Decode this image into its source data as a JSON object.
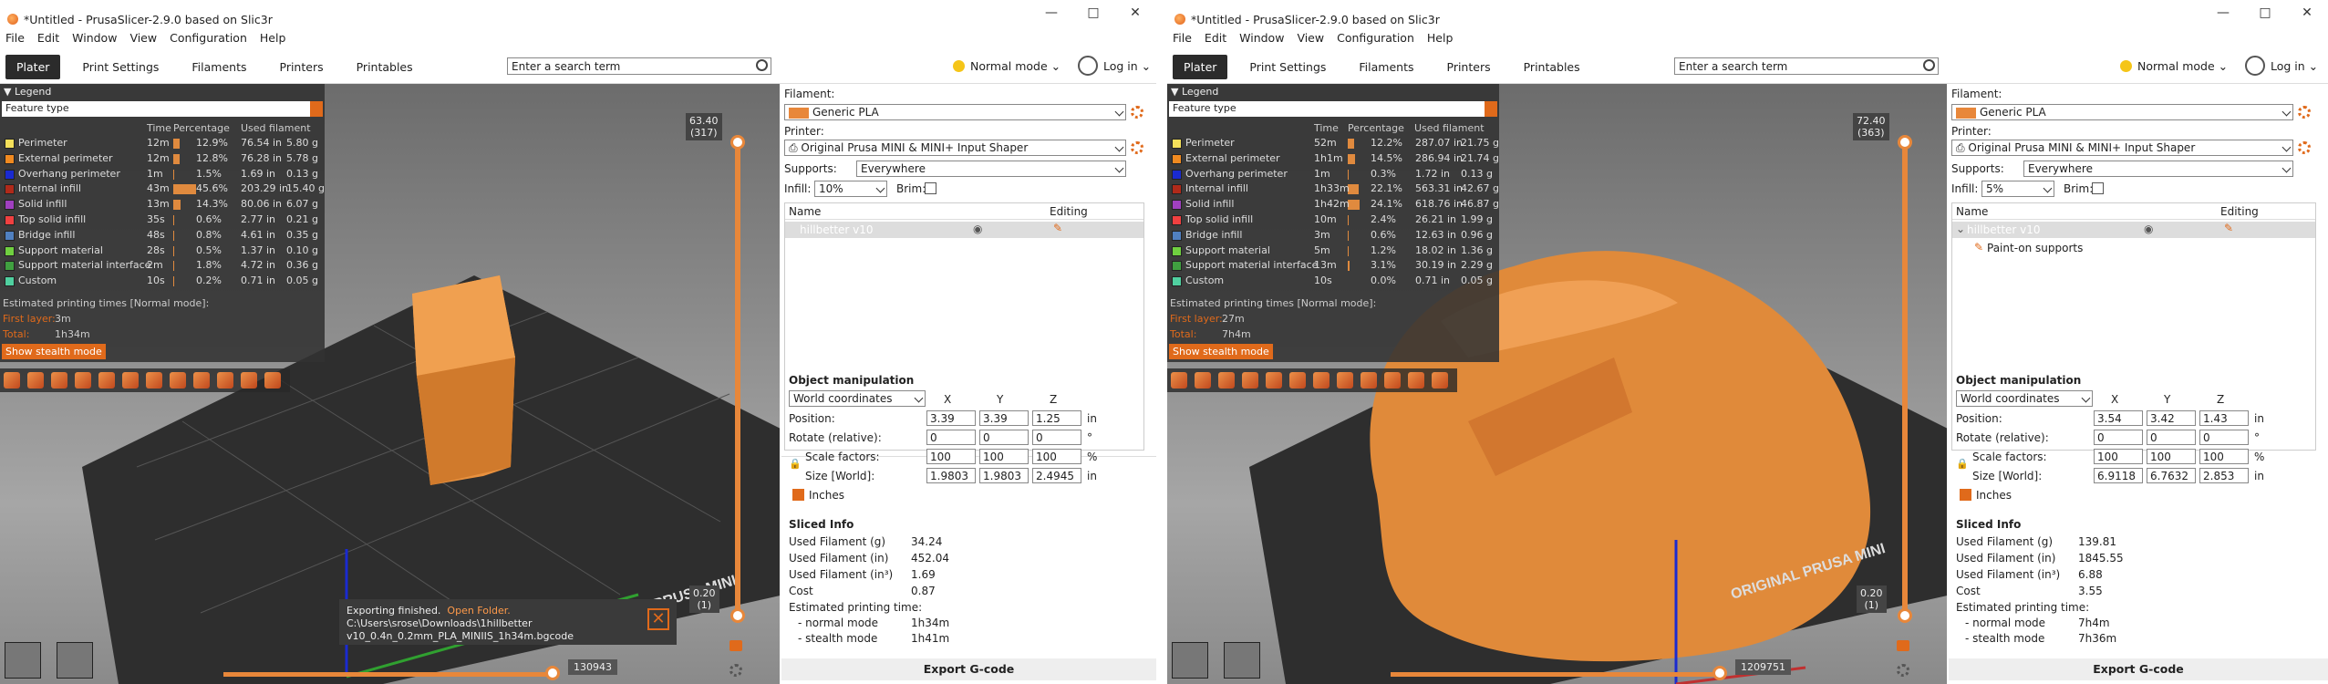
{
  "windows": [
    {
      "title": "*Untitled - PrusaSlicer-2.9.0 based on Slic3r",
      "menu": [
        "File",
        "Edit",
        "Window",
        "View",
        "Configuration",
        "Help"
      ],
      "tabs": [
        "Plater",
        "Print Settings",
        "Filaments",
        "Printers",
        "Printables"
      ],
      "search_placeholder": "Enter a search term",
      "mode": "Normal mode",
      "login": "Log in",
      "legend_title": "Legend",
      "feature_type": "Feature type",
      "legend_cols": [
        "Time",
        "Percentage",
        "Used filament"
      ],
      "legend_rows": [
        {
          "name": "Perimeter",
          "color": "#f5e05a",
          "time": "12m",
          "pct": "12.9%",
          "pct_val": 12.9,
          "len": "76.54 in",
          "g": "5.80 g"
        },
        {
          "name": "External perimeter",
          "color": "#f08a20",
          "time": "12m",
          "pct": "12.8%",
          "pct_val": 12.8,
          "len": "76.28 in",
          "g": "5.78 g"
        },
        {
          "name": "Overhang perimeter",
          "color": "#1a2ad0",
          "time": "1m",
          "pct": "1.5%",
          "pct_val": 1.5,
          "len": "1.69 in",
          "g": "0.13 g"
        },
        {
          "name": "Internal infill",
          "color": "#b02a1a",
          "time": "43m",
          "pct": "45.6%",
          "pct_val": 45.6,
          "len": "203.29 in",
          "g": "15.40 g"
        },
        {
          "name": "Solid infill",
          "color": "#a040c0",
          "time": "13m",
          "pct": "14.3%",
          "pct_val": 14.3,
          "len": "80.06 in",
          "g": "6.07 g"
        },
        {
          "name": "Top solid infill",
          "color": "#f04040",
          "time": "35s",
          "pct": "0.6%",
          "pct_val": 0.6,
          "len": "2.77 in",
          "g": "0.21 g"
        },
        {
          "name": "Bridge infill",
          "color": "#5080c0",
          "time": "48s",
          "pct": "0.8%",
          "pct_val": 0.8,
          "len": "4.61 in",
          "g": "0.35 g"
        },
        {
          "name": "Support material",
          "color": "#70d040",
          "time": "28s",
          "pct": "0.5%",
          "pct_val": 0.5,
          "len": "1.37 in",
          "g": "0.10 g"
        },
        {
          "name": "Support material interface",
          "color": "#40a040",
          "time": "2m",
          "pct": "1.8%",
          "pct_val": 1.8,
          "len": "4.72 in",
          "g": "0.36 g"
        },
        {
          "name": "Custom",
          "color": "#50d0a0",
          "time": "10s",
          "pct": "0.2%",
          "pct_val": 0.2,
          "len": "0.71 in",
          "g": "0.05 g"
        }
      ],
      "est_label": "Estimated printing times [Normal mode]:",
      "first_layer_label": "First layer:",
      "first_layer": "3m",
      "total_label": "Total:",
      "total": "1h34m",
      "stealth_btn": "Show stealth mode",
      "vslider_top": "63.40\n(317)",
      "vslider_bot": "0.20\n(1)",
      "hslider_val": "130943",
      "export_note_title": "Exporting finished.",
      "export_note_link": "Open Folder.",
      "export_note_path": "C:\\Users\\srose\\Downloads\\1hillbetter v10_0.4n_0.2mm_PLA_MINIIS_1h34m.bgcode",
      "bed_text": "ORIGINAL PRUSA MINI",
      "filament_label": "Filament:",
      "filament": "Generic PLA",
      "printer_label": "Printer:",
      "printer": "Original Prusa MINI & MINI+ Input Shaper",
      "supports_label": "Supports:",
      "supports": "Everywhere",
      "infill_label": "Infill:",
      "infill": "10%",
      "brim_label": "Brim:",
      "list_name": "Name",
      "list_editing": "Editing",
      "object": "hillbetter v10",
      "child": "",
      "om_title": "Object manipulation",
      "coords": "World coordinates",
      "axes": [
        "X",
        "Y",
        "Z"
      ],
      "position_label": "Position:",
      "position": [
        "3.39",
        "3.39",
        "1.25"
      ],
      "pos_unit": "in",
      "rotate_label": "Rotate (relative):",
      "rotate": [
        "0",
        "0",
        "0"
      ],
      "rot_unit": "°",
      "scale_label": "Scale factors:",
      "scale": [
        "100",
        "100",
        "100"
      ],
      "scale_unit": "%",
      "size_label": "Size [World]:",
      "size": [
        "1.9803",
        "1.9803",
        "2.4945"
      ],
      "size_unit": "in",
      "inches_label": "Inches",
      "sliced_title": "Sliced Info",
      "sliced": [
        [
          "Used Filament (g)",
          "34.24"
        ],
        [
          "Used Filament (in)",
          "452.04"
        ],
        [
          "Used Filament (in³)",
          "1.69"
        ],
        [
          "Cost",
          "0.87"
        ]
      ],
      "est_time_label": "Estimated printing time:",
      "normal_label": "- normal mode",
      "normal": "1h34m",
      "stealth_label": "- stealth mode",
      "stealth": "1h41m",
      "export_btn": "Export G-code"
    },
    {
      "title": "*Untitled - PrusaSlicer-2.9.0 based on Slic3r",
      "menu": [
        "File",
        "Edit",
        "Window",
        "View",
        "Configuration",
        "Help"
      ],
      "tabs": [
        "Plater",
        "Print Settings",
        "Filaments",
        "Printers",
        "Printables"
      ],
      "search_placeholder": "Enter a search term",
      "mode": "Normal mode",
      "login": "Log in",
      "legend_title": "Legend",
      "feature_type": "Feature type",
      "legend_cols": [
        "Time",
        "Percentage",
        "Used filament"
      ],
      "legend_rows": [
        {
          "name": "Perimeter",
          "color": "#f5e05a",
          "time": "52m",
          "pct": "12.2%",
          "pct_val": 12.2,
          "len": "287.07 in",
          "g": "21.75 g"
        },
        {
          "name": "External perimeter",
          "color": "#f08a20",
          "time": "1h1m",
          "pct": "14.5%",
          "pct_val": 14.5,
          "len": "286.94 in",
          "g": "21.74 g"
        },
        {
          "name": "Overhang perimeter",
          "color": "#1a2ad0",
          "time": "1m",
          "pct": "0.3%",
          "pct_val": 0.3,
          "len": "1.72 in",
          "g": "0.13 g"
        },
        {
          "name": "Internal infill",
          "color": "#b02a1a",
          "time": "1h33m",
          "pct": "22.1%",
          "pct_val": 22.1,
          "len": "563.31 in",
          "g": "42.67 g"
        },
        {
          "name": "Solid infill",
          "color": "#a040c0",
          "time": "1h42m",
          "pct": "24.1%",
          "pct_val": 24.1,
          "len": "618.76 in",
          "g": "46.87 g"
        },
        {
          "name": "Top solid infill",
          "color": "#f04040",
          "time": "10m",
          "pct": "2.4%",
          "pct_val": 2.4,
          "len": "26.21 in",
          "g": "1.99 g"
        },
        {
          "name": "Bridge infill",
          "color": "#5080c0",
          "time": "3m",
          "pct": "0.6%",
          "pct_val": 0.6,
          "len": "12.63 in",
          "g": "0.96 g"
        },
        {
          "name": "Support material",
          "color": "#70d040",
          "time": "5m",
          "pct": "1.2%",
          "pct_val": 1.2,
          "len": "18.02 in",
          "g": "1.36 g"
        },
        {
          "name": "Support material interface",
          "color": "#40a040",
          "time": "13m",
          "pct": "3.1%",
          "pct_val": 3.1,
          "len": "30.19 in",
          "g": "2.29 g"
        },
        {
          "name": "Custom",
          "color": "#50d0a0",
          "time": "10s",
          "pct": "0.0%",
          "pct_val": 0.0,
          "len": "0.71 in",
          "g": "0.05 g"
        }
      ],
      "est_label": "Estimated printing times [Normal mode]:",
      "first_layer_label": "First layer:",
      "first_layer": "27m",
      "total_label": "Total:",
      "total": "7h4m",
      "stealth_btn": "Show stealth mode",
      "vslider_top": "72.40\n(363)",
      "vslider_bot": "0.20\n(1)",
      "hslider_val": "1209751",
      "export_note_title": "",
      "export_note_link": "",
      "export_note_path": "",
      "bed_text": "ORIGINAL PRUSA MINI",
      "filament_label": "Filament:",
      "filament": "Generic PLA",
      "printer_label": "Printer:",
      "printer": "Original Prusa MINI & MINI+ Input Shaper",
      "supports_label": "Supports:",
      "supports": "Everywhere",
      "infill_label": "Infill:",
      "infill": "5%",
      "brim_label": "Brim:",
      "list_name": "Name",
      "list_editing": "Editing",
      "object": "hillbetter v10",
      "child": "Paint-on supports",
      "om_title": "Object manipulation",
      "coords": "World coordinates",
      "axes": [
        "X",
        "Y",
        "Z"
      ],
      "position_label": "Position:",
      "position": [
        "3.54",
        "3.42",
        "1.43"
      ],
      "pos_unit": "in",
      "rotate_label": "Rotate (relative):",
      "rotate": [
        "0",
        "0",
        "0"
      ],
      "rot_unit": "°",
      "scale_label": "Scale factors:",
      "scale": [
        "100",
        "100",
        "100"
      ],
      "scale_unit": "%",
      "size_label": "Size [World]:",
      "size": [
        "6.9118",
        "6.7632",
        "2.853"
      ],
      "size_unit": "in",
      "inches_label": "Inches",
      "sliced_title": "Sliced Info",
      "sliced": [
        [
          "Used Filament (g)",
          "139.81"
        ],
        [
          "Used Filament (in)",
          "1845.55"
        ],
        [
          "Used Filament (in³)",
          "6.88"
        ],
        [
          "Cost",
          "3.55"
        ]
      ],
      "est_time_label": "Estimated printing time:",
      "normal_label": "- normal mode",
      "normal": "7h4m",
      "stealth_label": "- stealth mode",
      "stealth": "7h36m",
      "export_btn": "Export G-code"
    }
  ]
}
